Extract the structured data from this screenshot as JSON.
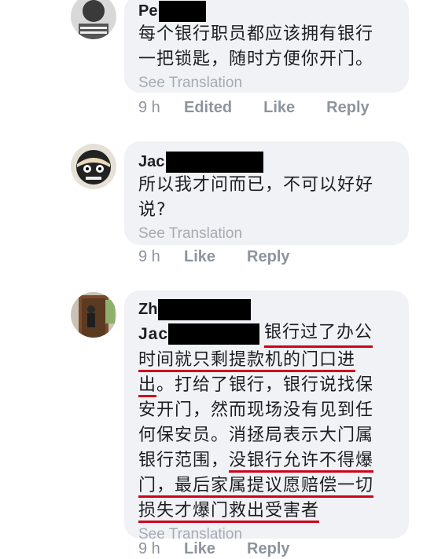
{
  "comments": [
    {
      "author_visible": "Pe",
      "body": "每个银行职员都应该拥有银行一把锁匙，随时方便你开门。",
      "line1": "每个银行职员都应该拥有银行",
      "line2": "一把锁匙，随时方便你开门。",
      "see_translation": "See Translation",
      "time": "9 h",
      "edited": "Edited",
      "like": "Like",
      "reply": "Reply"
    },
    {
      "author_visible": "Jac",
      "line1": "所以我才问而已，不可以好好",
      "line2": "说?",
      "see_translation": "See Translation",
      "time": "9 h",
      "like": "Like",
      "reply": "Reply"
    },
    {
      "author_visible": "Zh",
      "mention_visible": "Jac",
      "l1_tail": "银行过了办公",
      "l2": "时间就只剩提款机的门口进",
      "l3a": "出",
      "l3b": "。打给了银行，银行说找保",
      "l4": "安开门，然而现场没有见到任",
      "l5": "何保安员。消拯局表示大门属",
      "l6a": "银行范围，",
      "l6b": "没银行允许不得爆",
      "l7": "门，最后家属提议愿赔偿一切",
      "l8": "损失才爆门救出受害者",
      "see_translation": "See Translation",
      "time": "9 h",
      "like": "Like",
      "reply": "Reply"
    }
  ],
  "colors": {
    "bubble": "#f0f2f5",
    "action_text": "#8d949e",
    "see_translation": "#a6abb3",
    "underline": "#d0021b",
    "redaction": "#000000"
  }
}
